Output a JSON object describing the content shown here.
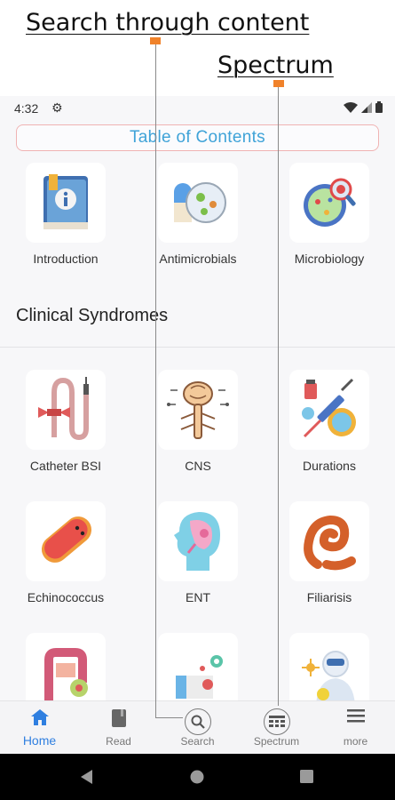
{
  "callouts": {
    "search_label": "Search through content",
    "spectrum_label": "Spectrum"
  },
  "status_bar": {
    "time": "4:32"
  },
  "toc": {
    "title": "Table of Contents"
  },
  "top_tiles": [
    {
      "label": "Introduction",
      "icon": "book-info-icon"
    },
    {
      "label": "Antimicrobials",
      "icon": "pill-bacteria-icon"
    },
    {
      "label": "Microbiology",
      "icon": "petri-dish-icon"
    }
  ],
  "section": {
    "heading": "Clinical Syndromes"
  },
  "syndrome_tiles": [
    {
      "label": "Catheter BSI",
      "icon": "catheter-icon"
    },
    {
      "label": "CNS",
      "icon": "brain-spine-icon"
    },
    {
      "label": "Durations",
      "icon": "syringe-icon"
    },
    {
      "label": "Echinococcus",
      "icon": "worm-cyst-icon"
    },
    {
      "label": "ENT",
      "icon": "head-ear-icon"
    },
    {
      "label": "Filiarisis",
      "icon": "coiled-worm-icon"
    },
    {
      "label": "",
      "icon": "intestine-icon"
    },
    {
      "label": "",
      "icon": "lab-cells-icon"
    },
    {
      "label": "",
      "icon": "protective-suit-icon"
    }
  ],
  "bottom_nav": [
    {
      "label": "Home",
      "icon": "home-icon",
      "active": true
    },
    {
      "label": "Read",
      "icon": "book-icon",
      "active": false
    },
    {
      "label": "Search",
      "icon": "search-icon",
      "active": false
    },
    {
      "label": "Spectrum",
      "icon": "spectrum-icon",
      "active": false
    },
    {
      "label": "more",
      "icon": "menu-icon",
      "active": false
    }
  ],
  "colors": {
    "accent": "#2f7fe0",
    "toc_text": "#3fa3d8",
    "callout_marker": "#f0822a"
  }
}
